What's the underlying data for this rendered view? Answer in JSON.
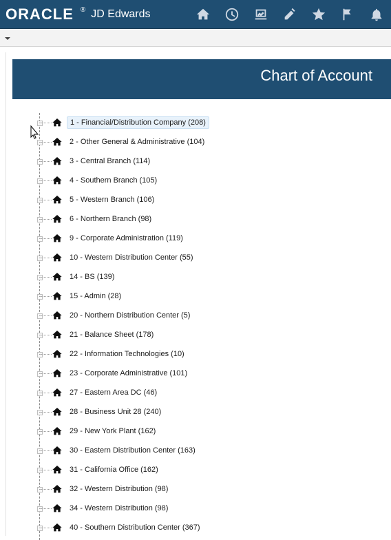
{
  "header": {
    "brand_oracle": "ORACLE",
    "brand_reg": "®",
    "brand_product": "JD Edwards",
    "icons": [
      "home-icon",
      "recent-icon",
      "dashboard-icon",
      "edit-icon",
      "favorites-icon",
      "flag-icon",
      "notifications-icon"
    ],
    "colors": {
      "primary": "#1f4e72",
      "icon": "#cfd8e3"
    }
  },
  "toolbar": {
    "dropdown_icon": "chevron-down-icon"
  },
  "page": {
    "title": "Chart of Account"
  },
  "tree": {
    "items": [
      {
        "label": "1 - Financial/Distribution Company (208)",
        "selected": true
      },
      {
        "label": "2 - Other General & Administrative (104)"
      },
      {
        "label": "3 - Central Branch (114)"
      },
      {
        "label": "4 - Southern Branch (105)"
      },
      {
        "label": "5 - Western Branch (106)"
      },
      {
        "label": "6 - Northern Branch (98)"
      },
      {
        "label": "9 - Corporate Administration (119)"
      },
      {
        "label": "10 - Western Distribution Center (55)"
      },
      {
        "label": "14 - BS (139)"
      },
      {
        "label": "15 - Admin (28)"
      },
      {
        "label": "20 - Northern Distribution Center (5)"
      },
      {
        "label": "21 - Balance Sheet (178)"
      },
      {
        "label": "22 - Information Technologies (10)"
      },
      {
        "label": "23 - Corporate Administrative (101)"
      },
      {
        "label": "27 - Eastern Area DC (46)"
      },
      {
        "label": "28 - Business Unit 28 (240)"
      },
      {
        "label": "29 - New York Plant (162)"
      },
      {
        "label": "30 - Eastern Distribution Center (163)"
      },
      {
        "label": "31 - California Office (162)"
      },
      {
        "label": "32 - Western Distribution (98)"
      },
      {
        "label": "34 - Western Distribution (98)"
      },
      {
        "label": "40 - Southern Distribution Center (367)"
      }
    ]
  }
}
